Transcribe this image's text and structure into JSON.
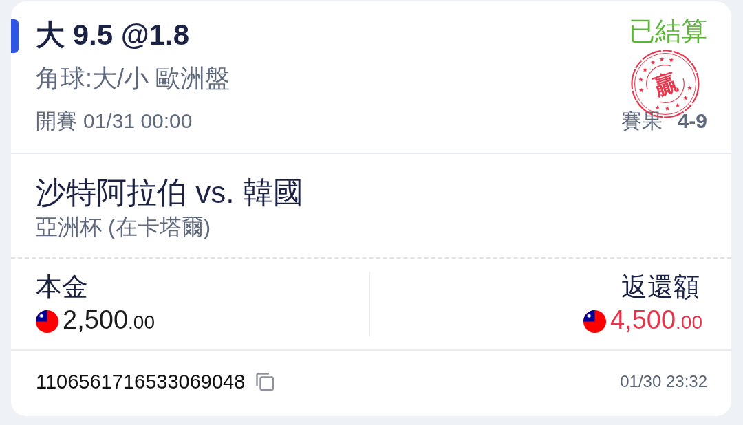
{
  "bet": {
    "selection": "大 9.5 @1.8",
    "status": "已結算",
    "market": "角球:大/小 歐洲盤",
    "kickoff": {
      "label": "開賽",
      "value": "01/31 00:00"
    },
    "result_stamp": {
      "text": "贏"
    },
    "score": {
      "label": "賽果",
      "value": "4-9"
    }
  },
  "match": {
    "teams": "沙特阿拉伯 vs. 韓國",
    "competition": "亞洲杯 (在卡塔爾)"
  },
  "stake": {
    "label": "本金",
    "amount": "2,500",
    "cents": ".00"
  },
  "return": {
    "label": "返還額",
    "amount": "4,500",
    "cents": ".00"
  },
  "footer": {
    "ticket_id": "1106561716533069048",
    "placed_at": "01/30 23:32"
  }
}
